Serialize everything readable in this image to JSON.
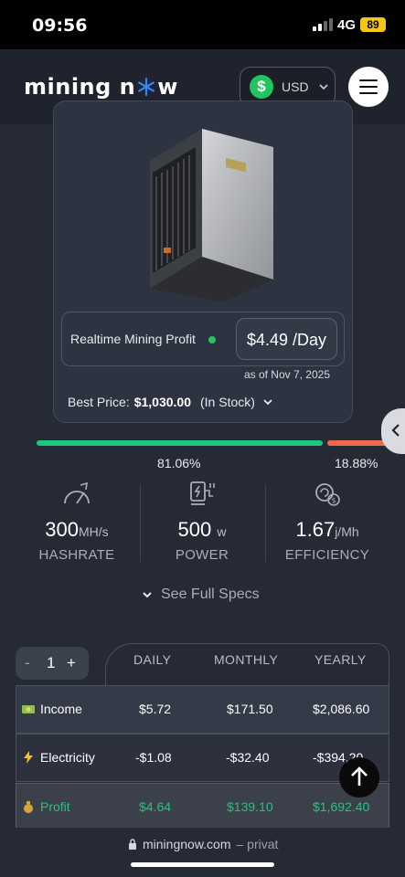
{
  "status": {
    "time": "09:56",
    "network": "4G",
    "battery": "89"
  },
  "header": {
    "logo_part1": "mining n",
    "logo_part2": "w",
    "currency": "USD",
    "currency_symbol": "$"
  },
  "product": {
    "profit_label": "Realtime Mining Profit",
    "profit_value": "$4.49 /Day",
    "as_of": "as of Nov 7, 2025",
    "best_price_label": "Best Price:",
    "best_price_value": "$1,030.00",
    "stock_status": "(In Stock)"
  },
  "profitability": {
    "green_fraction": 0.8106,
    "red_fraction": 0.1888,
    "green_label": "81.06%",
    "red_label": "18.88%"
  },
  "stats": [
    {
      "value": "300",
      "unit": "MH/s",
      "label": "HASHRATE",
      "icon": "speedometer-icon"
    },
    {
      "value": "500",
      "unit": "w",
      "label": "POWER",
      "icon": "power-plug-icon"
    },
    {
      "value": "1.67",
      "unit": "j/Mh",
      "label": "EFFICIENCY",
      "icon": "efficiency-icon"
    }
  ],
  "see_specs": "See Full Specs",
  "calculator": {
    "qty_minus": "-",
    "qty_value": "1",
    "qty_plus": "+",
    "periods": [
      "DAILY",
      "MONTHLY",
      "YEARLY"
    ],
    "rows": [
      {
        "label": "Income",
        "icon": "money-icon",
        "daily": "$5.72",
        "monthly": "$171.50",
        "yearly": "$2,086.60"
      },
      {
        "label": "Electricity",
        "icon": "lightning-icon",
        "daily": "-$1.08",
        "monthly": "-$32.40",
        "yearly": "-$394.20"
      },
      {
        "label": "Profit",
        "icon": "money-bag-icon",
        "daily": "$4.64",
        "monthly": "$139.10",
        "yearly": "$1,692.40"
      }
    ]
  },
  "browser": {
    "domain": "miningnow.com",
    "mode": "– privat"
  },
  "colors": {
    "accent_green": "#1fc77e",
    "accent_red": "#ef6a4d",
    "background": "#252a35"
  }
}
